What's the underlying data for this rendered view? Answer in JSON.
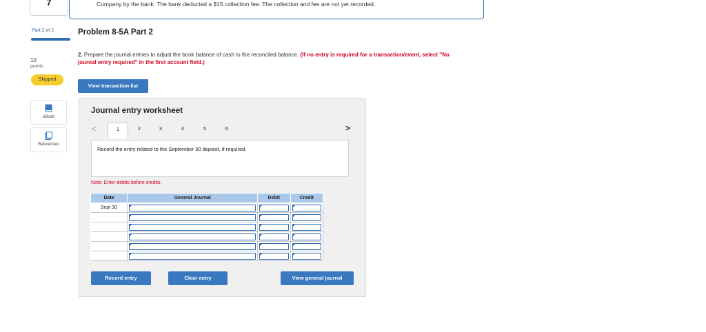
{
  "top": {
    "question_number": "7",
    "card_text": "Company by the bank. The bank deducted a $15 collection fee. The collection and fee are not yet recorded."
  },
  "rail": {
    "part_prefix": "Part 2",
    "part_suffix": "of 2",
    "points_value": "10",
    "points_label": "points",
    "status": "Skipped",
    "tools": [
      {
        "label": "eBook",
        "icon": "ebook-icon"
      },
      {
        "label": "References",
        "icon": "references-icon"
      }
    ]
  },
  "problem": {
    "title": "Problem 8-5A Part 2",
    "instruction_num": "2.",
    "instruction_text": " Prepare the journal entries to adjust the book balance of cash to the reconciled balance. ",
    "instruction_note": "(If no entry is required for a transaction/event, select \"No journal entry required\" in the first account field.)",
    "view_transactions_label": "View transaction list"
  },
  "worksheet": {
    "title": "Journal entry worksheet",
    "tabs": [
      "1",
      "2",
      "3",
      "4",
      "5",
      "6"
    ],
    "active_tab": "1",
    "entry_prompt": "Record the entry related to the September 30 deposit, if required.",
    "note": "Note: Enter debits before credits.",
    "columns": {
      "date": "Date",
      "account": "General Journal",
      "debit": "Debit",
      "credit": "Credit"
    },
    "rows": [
      {
        "date": "Sept 30",
        "account": "",
        "debit": "",
        "credit": ""
      },
      {
        "date": "",
        "account": "",
        "debit": "",
        "credit": ""
      },
      {
        "date": "",
        "account": "",
        "debit": "",
        "credit": ""
      },
      {
        "date": "",
        "account": "",
        "debit": "",
        "credit": ""
      },
      {
        "date": "",
        "account": "",
        "debit": "",
        "credit": ""
      },
      {
        "date": "",
        "account": "",
        "debit": "",
        "credit": ""
      }
    ],
    "record_label": "Record entry",
    "clear_label": "Clear entry",
    "view_journal_label": "View general journal"
  },
  "colors": {
    "accent": "#3a78c0",
    "header_fill": "#aac8ea",
    "skipped": "#f7cd2e",
    "alert": "#d0021b"
  }
}
